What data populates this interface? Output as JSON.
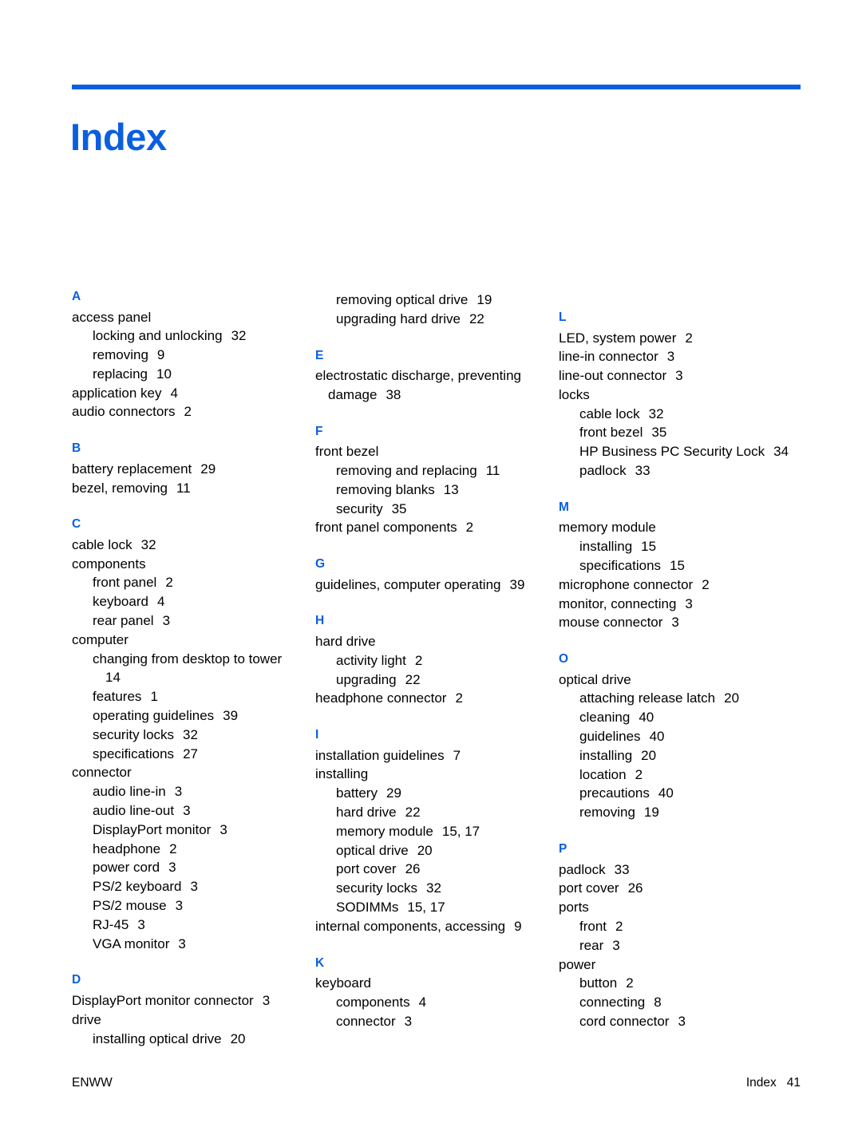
{
  "document": {
    "title": "Index",
    "accent_color": "#0a5fe0",
    "text_color": "#000000"
  },
  "footer": {
    "left": "ENWW",
    "right_label": "Index",
    "right_page": "41"
  },
  "columns": [
    {
      "name": "column-1",
      "sections": [
        {
          "letter": "A",
          "entries": [
            {
              "level": 1,
              "text": "access panel",
              "page": ""
            },
            {
              "level": 2,
              "text": "locking and unlocking",
              "page": "32"
            },
            {
              "level": 2,
              "text": "removing",
              "page": "9"
            },
            {
              "level": 2,
              "text": "replacing",
              "page": "10"
            },
            {
              "level": 1,
              "text": "application key",
              "page": "4"
            },
            {
              "level": 1,
              "text": "audio connectors",
              "page": "2"
            }
          ]
        },
        {
          "letter": "B",
          "entries": [
            {
              "level": 1,
              "text": "battery replacement",
              "page": "29"
            },
            {
              "level": 1,
              "text": "bezel, removing",
              "page": "11"
            }
          ]
        },
        {
          "letter": "C",
          "entries": [
            {
              "level": 1,
              "text": "cable lock",
              "page": "32"
            },
            {
              "level": 1,
              "text": "components",
              "page": ""
            },
            {
              "level": 2,
              "text": "front panel",
              "page": "2"
            },
            {
              "level": 2,
              "text": "keyboard",
              "page": "4"
            },
            {
              "level": 2,
              "text": "rear panel",
              "page": "3"
            },
            {
              "level": 1,
              "text": "computer",
              "page": ""
            },
            {
              "level": 2,
              "text": "changing from desktop to tower",
              "page": "14"
            },
            {
              "level": 2,
              "text": "features",
              "page": "1"
            },
            {
              "level": 2,
              "text": "operating guidelines",
              "page": "39"
            },
            {
              "level": 2,
              "text": "security locks",
              "page": "32"
            },
            {
              "level": 2,
              "text": "specifications",
              "page": "27"
            },
            {
              "level": 1,
              "text": "connector",
              "page": ""
            },
            {
              "level": 2,
              "text": "audio line-in",
              "page": "3"
            },
            {
              "level": 2,
              "text": "audio line-out",
              "page": "3"
            },
            {
              "level": 2,
              "text": "DisplayPort monitor",
              "page": "3"
            },
            {
              "level": 2,
              "text": "headphone",
              "page": "2"
            },
            {
              "level": 2,
              "text": "power cord",
              "page": "3"
            },
            {
              "level": 2,
              "text": "PS/2 keyboard",
              "page": "3"
            },
            {
              "level": 2,
              "text": "PS/2 mouse",
              "page": "3"
            },
            {
              "level": 2,
              "text": "RJ-45",
              "page": "3"
            },
            {
              "level": 2,
              "text": "VGA monitor",
              "page": "3"
            }
          ]
        },
        {
          "letter": "D",
          "entries": [
            {
              "level": 1,
              "text": "DisplayPort monitor connector",
              "page": "3"
            },
            {
              "level": 1,
              "text": "drive",
              "page": ""
            },
            {
              "level": 2,
              "text": "installing optical drive",
              "page": "20"
            }
          ]
        }
      ]
    },
    {
      "name": "column-2",
      "sections": [
        {
          "letter": "",
          "entries": [
            {
              "level": 2,
              "text": "removing optical drive",
              "page": "19"
            },
            {
              "level": 2,
              "text": "upgrading hard drive",
              "page": "22"
            }
          ]
        },
        {
          "letter": "E",
          "entries": [
            {
              "level": 1,
              "text": "electrostatic discharge, preventing damage",
              "page": "38"
            }
          ]
        },
        {
          "letter": "F",
          "entries": [
            {
              "level": 1,
              "text": "front bezel",
              "page": ""
            },
            {
              "level": 2,
              "text": "removing and replacing",
              "page": "11"
            },
            {
              "level": 2,
              "text": "removing blanks",
              "page": "13"
            },
            {
              "level": 2,
              "text": "security",
              "page": "35"
            },
            {
              "level": 1,
              "text": "front panel components",
              "page": "2"
            }
          ]
        },
        {
          "letter": "G",
          "entries": [
            {
              "level": 1,
              "text": "guidelines, computer operating",
              "page": "39"
            }
          ]
        },
        {
          "letter": "H",
          "entries": [
            {
              "level": 1,
              "text": "hard drive",
              "page": ""
            },
            {
              "level": 2,
              "text": "activity light",
              "page": "2"
            },
            {
              "level": 2,
              "text": "upgrading",
              "page": "22"
            },
            {
              "level": 1,
              "text": "headphone connector",
              "page": "2"
            }
          ]
        },
        {
          "letter": "I",
          "entries": [
            {
              "level": 1,
              "text": "installation guidelines",
              "page": "7"
            },
            {
              "level": 1,
              "text": "installing",
              "page": ""
            },
            {
              "level": 2,
              "text": "battery",
              "page": "29"
            },
            {
              "level": 2,
              "text": "hard drive",
              "page": "22"
            },
            {
              "level": 2,
              "text": "memory module",
              "page": "15, 17"
            },
            {
              "level": 2,
              "text": "optical drive",
              "page": "20"
            },
            {
              "level": 2,
              "text": "port cover",
              "page": "26"
            },
            {
              "level": 2,
              "text": "security locks",
              "page": "32"
            },
            {
              "level": 2,
              "text": "SODIMMs",
              "page": "15, 17"
            },
            {
              "level": 1,
              "text": "internal components, accessing",
              "page": "9"
            }
          ]
        },
        {
          "letter": "K",
          "entries": [
            {
              "level": 1,
              "text": "keyboard",
              "page": ""
            },
            {
              "level": 2,
              "text": "components",
              "page": "4"
            },
            {
              "level": 2,
              "text": "connector",
              "page": "3"
            }
          ]
        }
      ]
    },
    {
      "name": "column-3",
      "sections": [
        {
          "letter": "L",
          "entries": [
            {
              "level": 1,
              "text": "LED, system power",
              "page": "2"
            },
            {
              "level": 1,
              "text": "line-in connector",
              "page": "3"
            },
            {
              "level": 1,
              "text": "line-out connector",
              "page": "3"
            },
            {
              "level": 1,
              "text": "locks",
              "page": ""
            },
            {
              "level": 2,
              "text": "cable lock",
              "page": "32"
            },
            {
              "level": 2,
              "text": "front bezel",
              "page": "35"
            },
            {
              "level": 2,
              "text": "HP Business PC Security Lock",
              "page": "34"
            },
            {
              "level": 2,
              "text": "padlock",
              "page": "33"
            }
          ]
        },
        {
          "letter": "M",
          "entries": [
            {
              "level": 1,
              "text": "memory module",
              "page": ""
            },
            {
              "level": 2,
              "text": "installing",
              "page": "15"
            },
            {
              "level": 2,
              "text": "specifications",
              "page": "15"
            },
            {
              "level": 1,
              "text": "microphone connector",
              "page": "2"
            },
            {
              "level": 1,
              "text": "monitor, connecting",
              "page": "3"
            },
            {
              "level": 1,
              "text": "mouse connector",
              "page": "3"
            }
          ]
        },
        {
          "letter": "O",
          "entries": [
            {
              "level": 1,
              "text": "optical drive",
              "page": ""
            },
            {
              "level": 2,
              "text": "attaching release latch",
              "page": "20"
            },
            {
              "level": 2,
              "text": "cleaning",
              "page": "40"
            },
            {
              "level": 2,
              "text": "guidelines",
              "page": "40"
            },
            {
              "level": 2,
              "text": "installing",
              "page": "20"
            },
            {
              "level": 2,
              "text": "location",
              "page": "2"
            },
            {
              "level": 2,
              "text": "precautions",
              "page": "40"
            },
            {
              "level": 2,
              "text": "removing",
              "page": "19"
            }
          ]
        },
        {
          "letter": "P",
          "entries": [
            {
              "level": 1,
              "text": "padlock",
              "page": "33"
            },
            {
              "level": 1,
              "text": "port cover",
              "page": "26"
            },
            {
              "level": 1,
              "text": "ports",
              "page": ""
            },
            {
              "level": 2,
              "text": "front",
              "page": "2"
            },
            {
              "level": 2,
              "text": "rear",
              "page": "3"
            },
            {
              "level": 1,
              "text": "power",
              "page": ""
            },
            {
              "level": 2,
              "text": "button",
              "page": "2"
            },
            {
              "level": 2,
              "text": "connecting",
              "page": "8"
            },
            {
              "level": 2,
              "text": "cord connector",
              "page": "3"
            }
          ]
        }
      ]
    }
  ]
}
